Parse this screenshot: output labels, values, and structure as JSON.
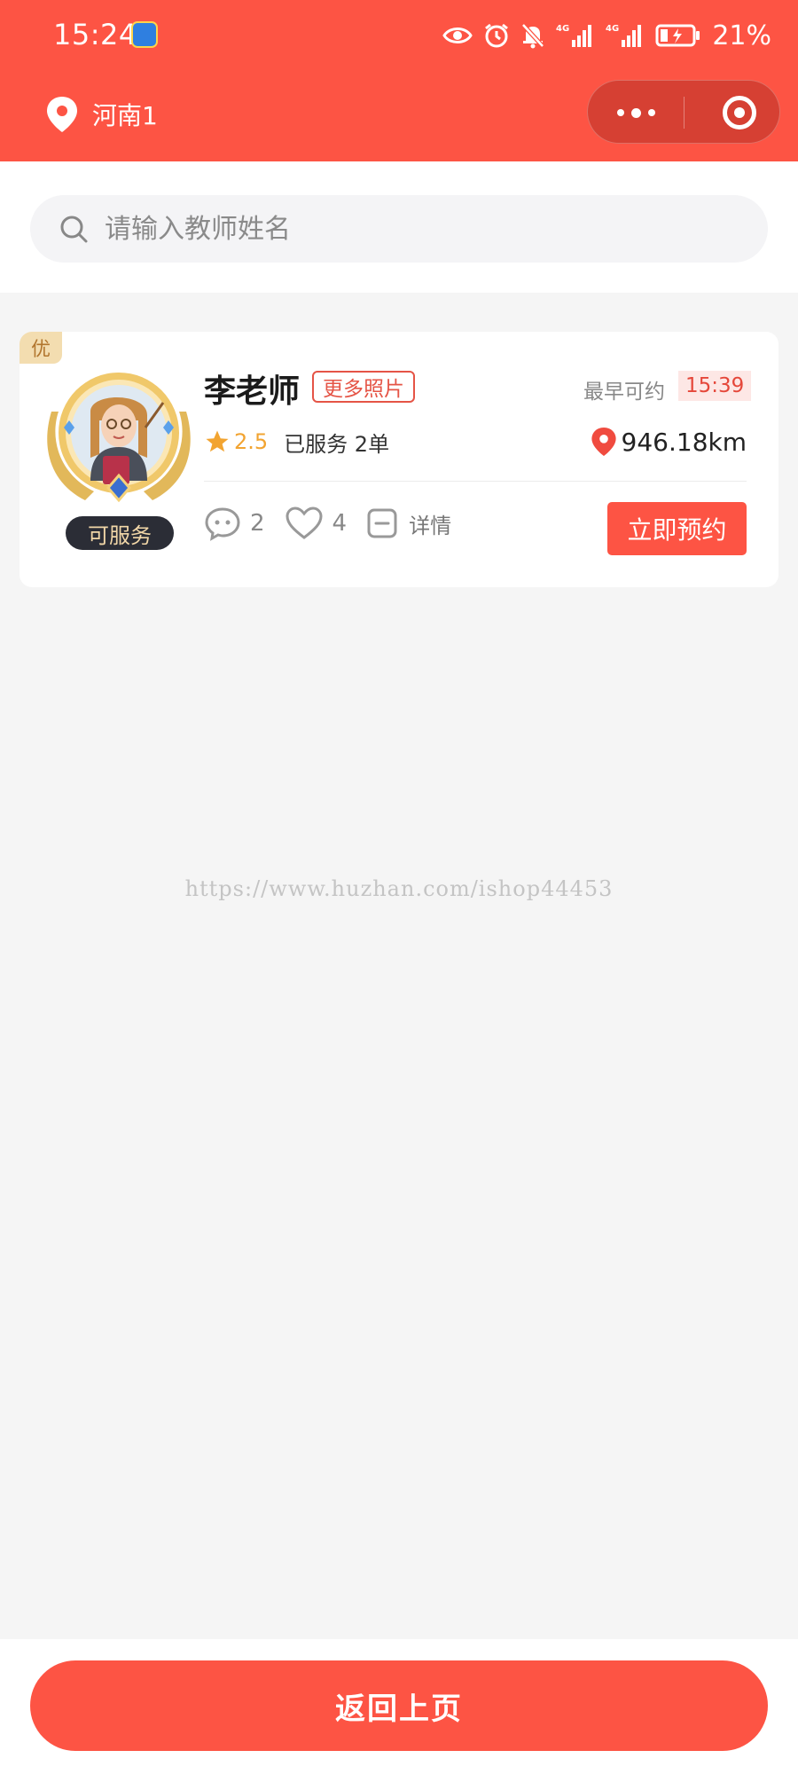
{
  "status_bar": {
    "time": "15:24",
    "battery": "21%",
    "icons": [
      "app-badge-icon",
      "eye-icon",
      "alarm-icon",
      "bell-off-icon",
      "signal-4g-icon",
      "signal-4g-icon",
      "battery-charging-icon"
    ]
  },
  "header": {
    "location": "河南1",
    "location_icon": "location-pin-icon",
    "capsule": [
      "more-dots-icon",
      "target-icon"
    ]
  },
  "search": {
    "placeholder": "请输入教师姓名"
  },
  "teachers": [
    {
      "tag": "优",
      "name": "李老师",
      "more_photos": "更多照片",
      "earliest_label": "最早可约",
      "earliest_time": "15:39",
      "rating": "2.5",
      "served": "已服务 2单",
      "distance": "946.18km",
      "status": "可服务",
      "comments": "2",
      "likes": "4",
      "detail": "详情",
      "book": "立即预约"
    }
  ],
  "watermark": "https://www.huzhan.com/ishop44453",
  "footer": {
    "back": "返回上页"
  },
  "colors": {
    "brand": "#fd5444",
    "rating": "#f2a431",
    "tag_bg": "#f3ddb0"
  }
}
